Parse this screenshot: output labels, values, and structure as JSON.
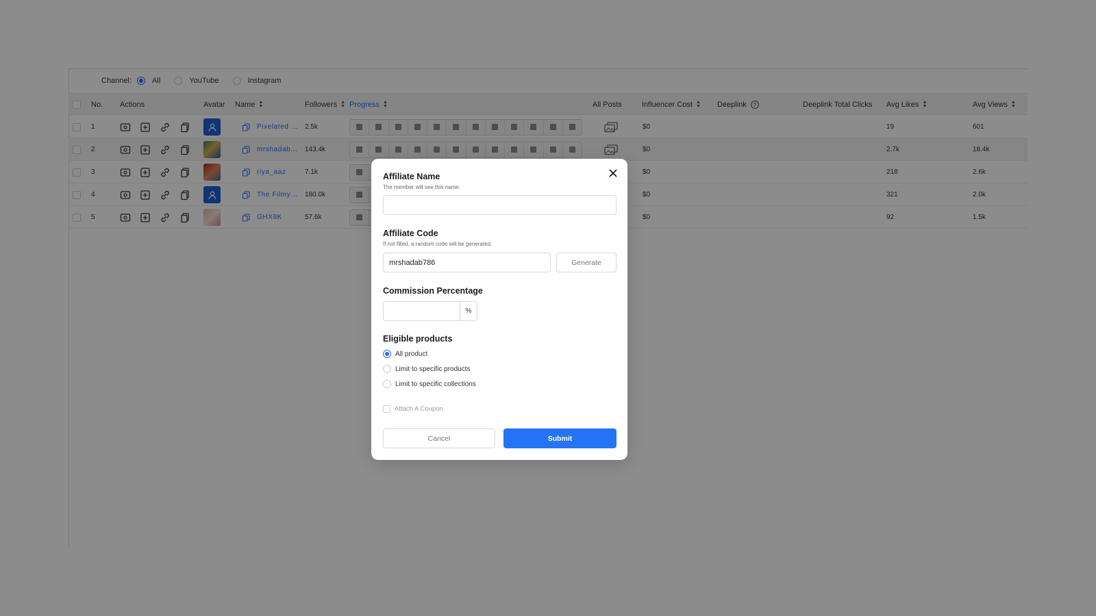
{
  "filters": {
    "channel_label": "Channel:",
    "options": [
      {
        "label": "All",
        "selected": true
      },
      {
        "label": "YouTube",
        "selected": false
      },
      {
        "label": "Instagram",
        "selected": false
      }
    ]
  },
  "table": {
    "headers": {
      "no": "No.",
      "actions": "Actions",
      "avatar": "Avatar",
      "name": "Name",
      "followers": "Followers",
      "progress": "Progress",
      "all_posts": "All Posts",
      "influencer_cost": "Influencer Cost",
      "deeplink": "Deeplink",
      "deeplink_clicks": "Deeplink Total Clicks",
      "avg_likes": "Avg Likes",
      "avg_views": "Avg Views"
    },
    "rows": [
      {
        "no": "1",
        "name": "Pixelated R...",
        "followers": "2.5k",
        "cost": "$0",
        "likes": "19",
        "views": "601"
      },
      {
        "no": "2",
        "name": "mrshadab...",
        "followers": "143.4k",
        "cost": "$0",
        "likes": "2.7k",
        "views": "18.4k"
      },
      {
        "no": "3",
        "name": "riya_aaz",
        "followers": "7.1k",
        "cost": "$0",
        "likes": "218",
        "views": "2.6k"
      },
      {
        "no": "4",
        "name": "The Filmy ...",
        "followers": "180.0k",
        "cost": "$0",
        "likes": "321",
        "views": "2.0k"
      },
      {
        "no": "5",
        "name": "GHX9K",
        "followers": "57.6k",
        "cost": "$0",
        "likes": "92",
        "views": "1.5k"
      }
    ]
  },
  "modal": {
    "affiliate_name": {
      "title": "Affiliate Name",
      "hint": "The member will see this name.",
      "value": ""
    },
    "affiliate_code": {
      "title": "Affiliate Code",
      "hint": "If not filled, a random code will be generated.",
      "value": "mrshadab786",
      "generate_label": "Generate"
    },
    "commission": {
      "title": "Commission Percentage",
      "value": "",
      "suffix": "%"
    },
    "eligible": {
      "title": "Eligible products",
      "options": [
        {
          "label": "All product",
          "selected": true
        },
        {
          "label": "Limit to specific products",
          "selected": false
        },
        {
          "label": "Limit to specific collections",
          "selected": false
        }
      ]
    },
    "coupon_label": "Attach A Coupon",
    "cancel_label": "Cancel",
    "submit_label": "Submit"
  },
  "colors": {
    "accent": "#2474f5",
    "overlay": "rgba(0,0,0,0.45)"
  }
}
